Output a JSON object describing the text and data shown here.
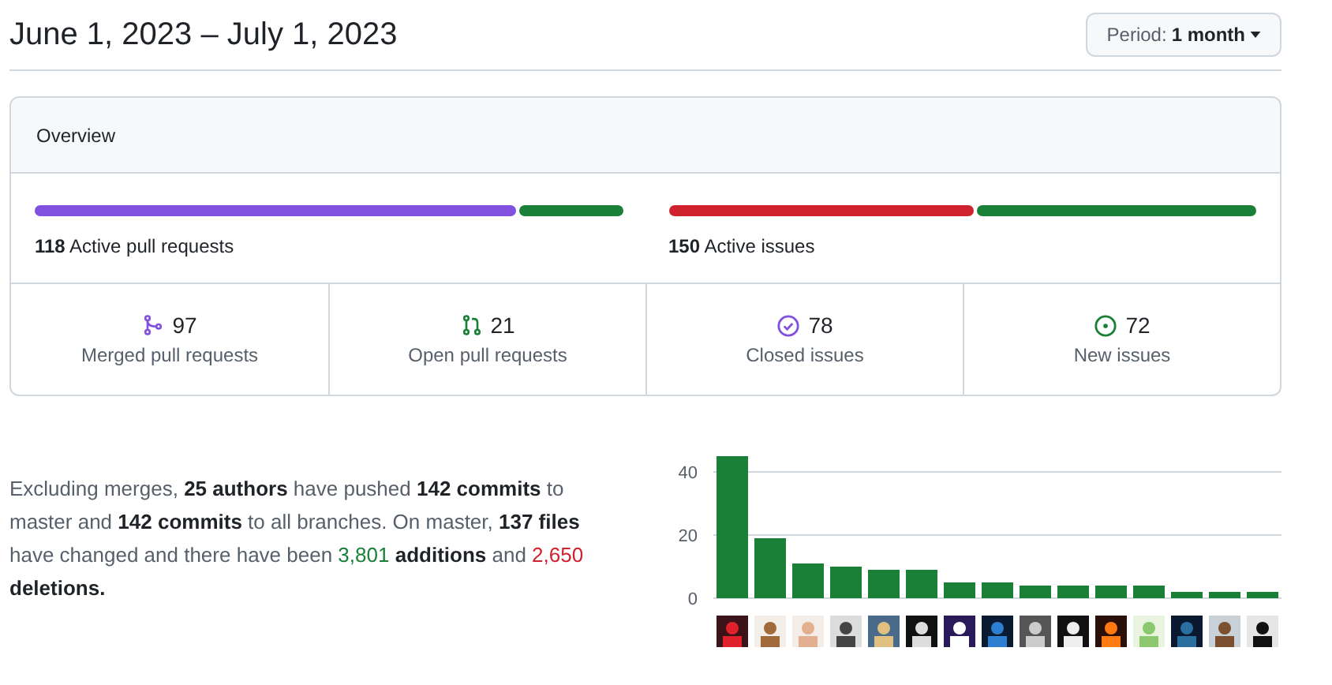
{
  "header": {
    "title": "June 1, 2023 – July 1, 2023",
    "period_label": "Period:",
    "period_value": "1 month"
  },
  "overview": {
    "title": "Overview",
    "bars": [
      {
        "kind": "pulls",
        "count": "118",
        "label": "Active pull requests",
        "level": 0.82
      },
      {
        "kind": "issues",
        "count": "150",
        "label": "Active issues",
        "level": 0.52
      }
    ],
    "stats": [
      {
        "kind": "merged",
        "count": "97",
        "label": "Merged pull requests"
      },
      {
        "kind": "open-pr",
        "count": "21",
        "label": "Open pull requests"
      },
      {
        "kind": "closed",
        "count": "78",
        "label": "Closed issues"
      },
      {
        "kind": "new",
        "count": "72",
        "label": "New issues"
      }
    ]
  },
  "summary": "Excluding merges, **25 authors** have pushed **142 commits** to master and **142 commits** to all branches. On master, **137 files** have changed and there have been ",
  "additions": "3,801",
  "additions_label": "additions",
  "and": " and ",
  "deletions": "2,650",
  "deletions_label": "deletions.",
  "chart_data": {
    "type": "bar",
    "ylim": [
      0,
      45
    ],
    "yticks": [
      0,
      20,
      40
    ],
    "values": [
      45,
      19,
      11,
      10,
      9,
      9,
      5,
      5,
      4,
      4,
      4,
      4,
      2,
      2,
      2
    ]
  }
}
